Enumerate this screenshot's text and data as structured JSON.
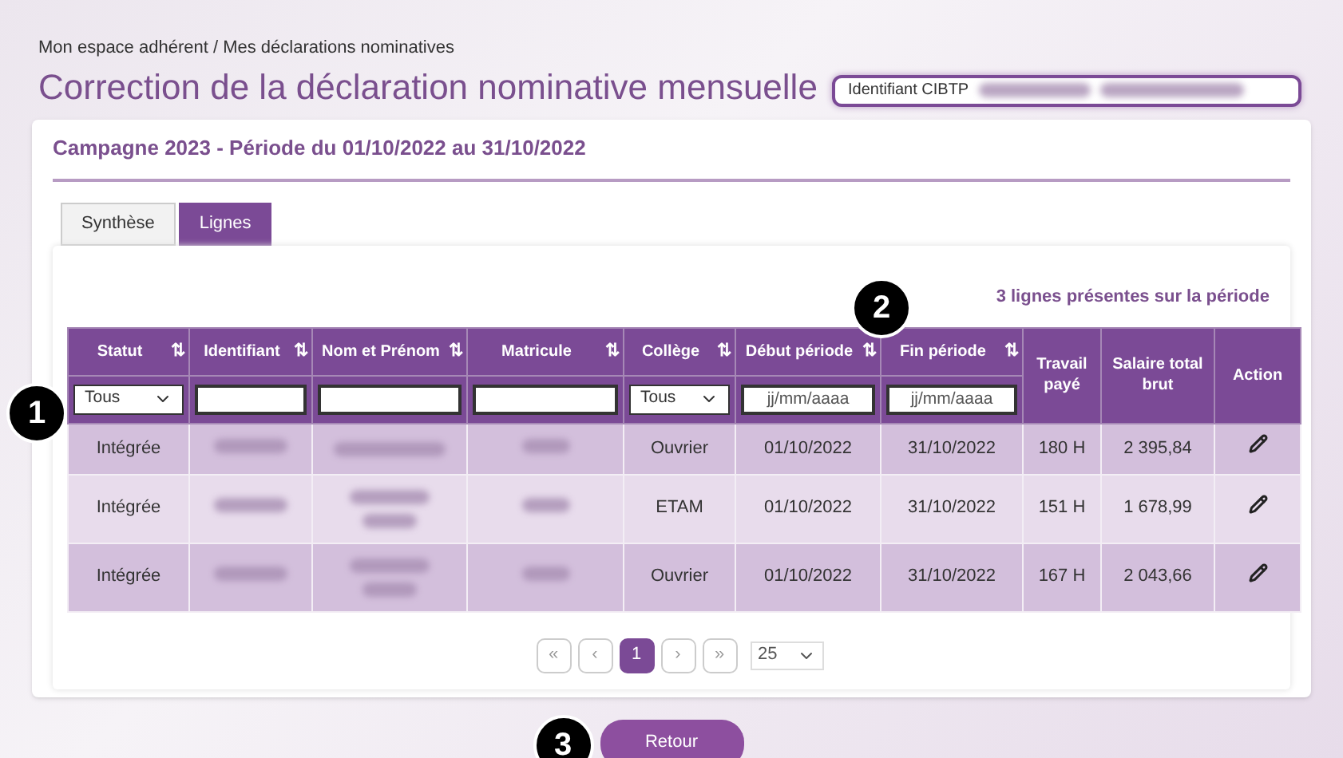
{
  "breadcrumb": "Mon espace adhérent / Mes déclarations nominatives",
  "title": "Correction de la déclaration nominative mensuelle",
  "identifier": {
    "label": "Identifiant CIBTP"
  },
  "campaign": "Campagne 2023 - Période du 01/10/2022 au 31/10/2022",
  "tabs": [
    {
      "label": "Synthèse",
      "selected": false
    },
    {
      "label": "Lignes",
      "selected": true
    }
  ],
  "count_text": "3 lignes présentes sur la période",
  "table": {
    "columns": [
      {
        "label": "Statut",
        "sort": "⇅",
        "filter": {
          "kind": "select",
          "value": "Tous"
        }
      },
      {
        "label": "Identifiant",
        "sort": "⇅",
        "filter": {
          "kind": "text"
        }
      },
      {
        "label": "Nom et Prénom",
        "sort": "⇅",
        "filter": {
          "kind": "text"
        }
      },
      {
        "label": "Matricule",
        "sort": "⇅",
        "filter": {
          "kind": "text"
        }
      },
      {
        "label": "Collège",
        "sort": "⇅",
        "filter": {
          "kind": "select",
          "value": "Tous"
        }
      },
      {
        "label": "Début période",
        "sort": "⇅",
        "filter": {
          "kind": "text",
          "placeholder": "jj/mm/aaaa"
        }
      },
      {
        "label": "Fin période",
        "sort": "⇅",
        "filter": {
          "kind": "text",
          "placeholder": "jj/mm/aaaa"
        }
      },
      {
        "label": "Travail payé"
      },
      {
        "label": "Salaire total brut"
      },
      {
        "label": "Action"
      }
    ],
    "rows": [
      {
        "statut": "Intégrée",
        "wrapped_name": false,
        "college": "Ouvrier",
        "debut": "01/10/2022",
        "fin": "31/10/2022",
        "travail": "180 H",
        "salaire": "2 395,84"
      },
      {
        "statut": "Intégrée",
        "wrapped_name": true,
        "college": "ETAM",
        "debut": "01/10/2022",
        "fin": "31/10/2022",
        "travail": "151 H",
        "salaire": "1 678,99"
      },
      {
        "statut": "Intégrée",
        "wrapped_name": true,
        "college": "Ouvrier",
        "debut": "01/10/2022",
        "fin": "31/10/2022",
        "travail": "167 H",
        "salaire": "2 043,66"
      }
    ]
  },
  "pagination": {
    "pages": [
      {
        "label": "«",
        "kind": "nav"
      },
      {
        "label": "‹",
        "kind": "nav"
      },
      {
        "label": "1",
        "kind": "page",
        "selected": true
      },
      {
        "label": "›",
        "kind": "nav"
      },
      {
        "label": "»",
        "kind": "nav"
      }
    ],
    "page_size": "25"
  },
  "back_button": "Retour",
  "callouts": [
    "1",
    "2",
    "3"
  ]
}
